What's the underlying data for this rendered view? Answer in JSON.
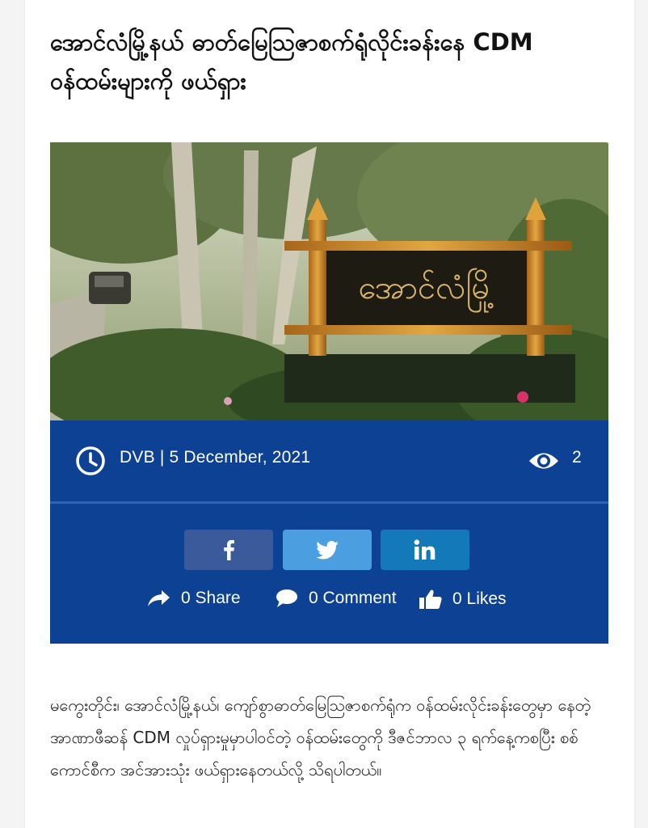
{
  "article": {
    "title": "အောင်လံမြို့နယ် ဓာတ်မြေသြဇာစက်ရုံလိုင်းခန်းနေ CDM ဝန်ထမ်းများကို ဖယ်ရှား",
    "image": {
      "sign_text": "အောင်လံမြို့"
    },
    "byline": "DVB | 5 December, 2021",
    "views": "2",
    "body": "မကွေးတိုင်း၊ အောင်လံမြို့နယ်၊ ကျော်စွာဓာတ်မြေသြဇာစက်ရုံက ဝန်ထမ်းလိုင်းခန်းတွေမှာ နေတဲ့ အာဏာဖီဆန် CDM လှုပ်ရှားမှုမှာပါဝင်တဲ့ ဝန်ထမ်းတွေကို ဒီဇင်ဘာလ ၃ ရက်နေ့ကစပြီး စစ်ကောင်စီက အင်အားသုံး ဖယ်ရှားနေတယ်လို့ သိရပါတယ်။"
  },
  "social": {
    "share_label": "0 Share",
    "comment_label": "0 Comment",
    "likes_label": "0 Likes"
  },
  "icons": {
    "clock": "clock-icon",
    "views": "eye-icon",
    "facebook": "facebook-icon",
    "twitter": "twitter-icon",
    "linkedin": "linkedin-icon",
    "share": "share-arrow-icon",
    "comment": "comment-bubble-icon",
    "likes": "thumbs-up-icon"
  },
  "colors": {
    "meta_bg": "#0d4194",
    "facebook": "#3a5a9b",
    "twitter": "#4b9fe0",
    "linkedin": "#1479b9"
  }
}
